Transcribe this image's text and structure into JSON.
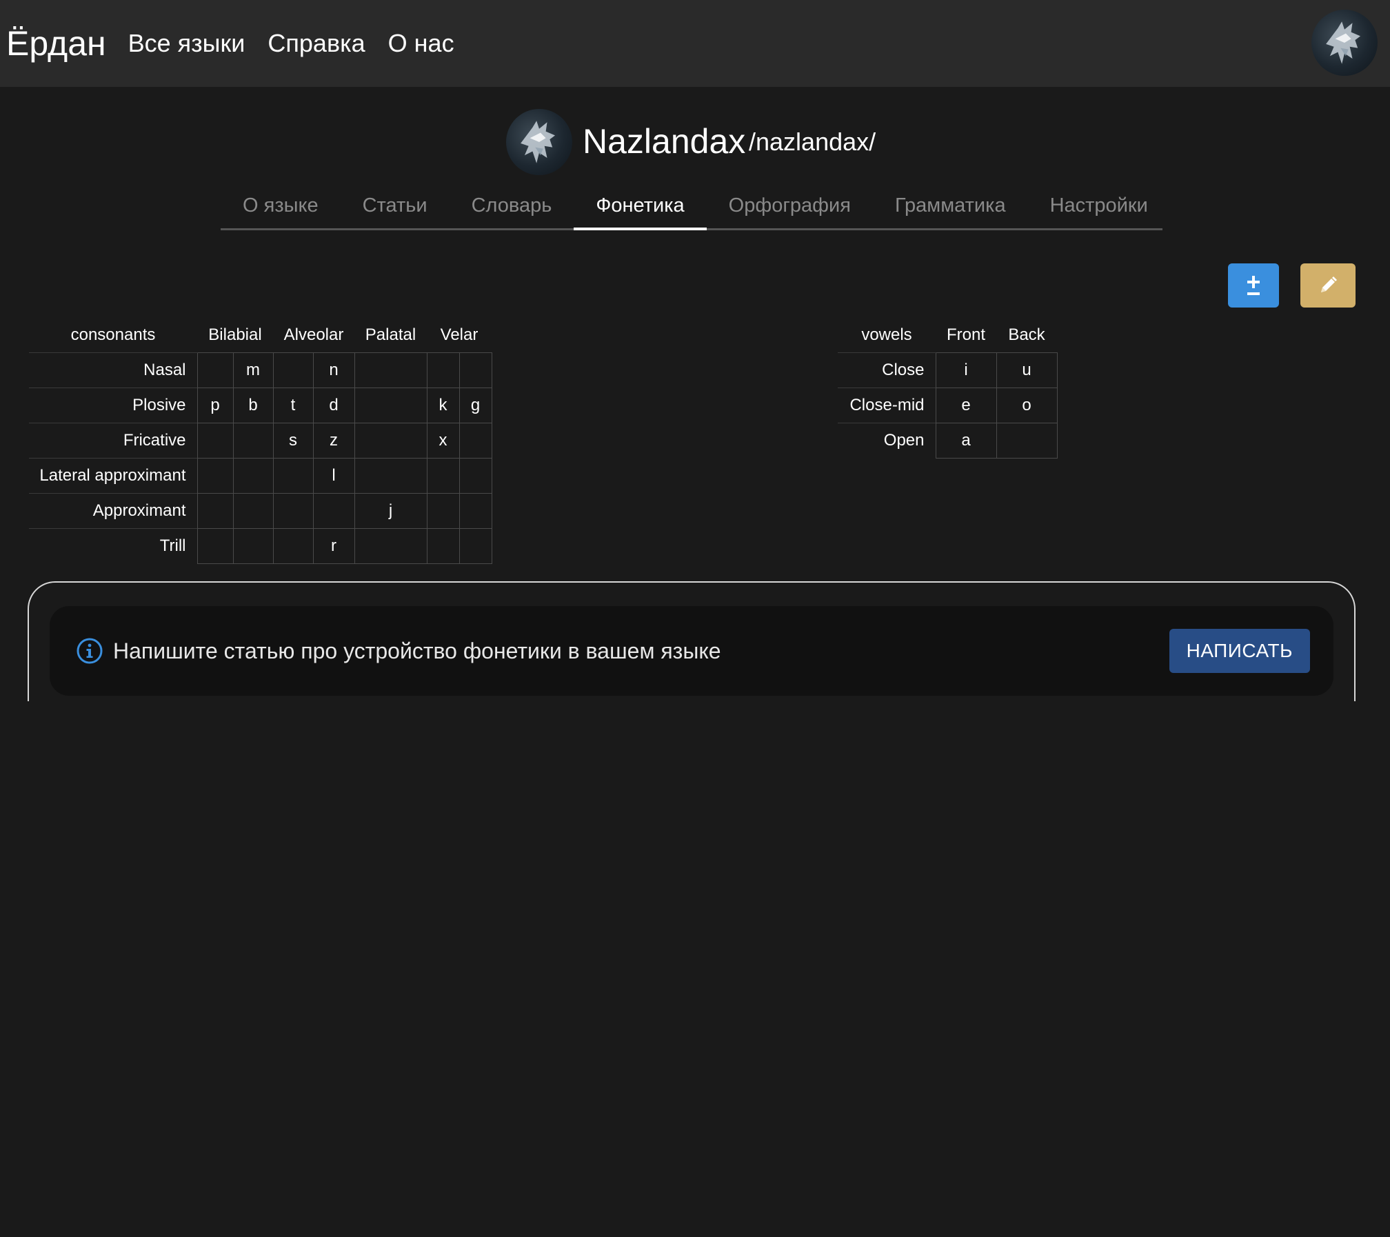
{
  "header": {
    "brand": "Ёрдан",
    "nav": [
      "Все языки",
      "Справка",
      "О нас"
    ]
  },
  "language": {
    "name": "Nazlandax",
    "transliteration": "/nazlandax/"
  },
  "tabs": [
    {
      "label": "О языке",
      "active": false
    },
    {
      "label": "Статьи",
      "active": false
    },
    {
      "label": "Словарь",
      "active": false
    },
    {
      "label": "Фонетика",
      "active": true
    },
    {
      "label": "Орфография",
      "active": false
    },
    {
      "label": "Грамматика",
      "active": false
    },
    {
      "label": "Настройки",
      "active": false
    }
  ],
  "toolbar": {
    "add_icon": "plus-minus-icon",
    "edit_icon": "pencil-icon",
    "add_color": "#3a8fde",
    "edit_color": "#d2b06a"
  },
  "consonants": {
    "title": "consonants",
    "places": [
      "Bilabial",
      "Alveolar",
      "Palatal",
      "Velar"
    ],
    "rows": [
      {
        "manner": "Nasal",
        "cells": [
          "",
          "m",
          "",
          "n",
          "",
          "",
          ""
        ]
      },
      {
        "manner": "Plosive",
        "cells": [
          "p",
          "b",
          "t",
          "d",
          "",
          "k",
          "g"
        ]
      },
      {
        "manner": "Fricative",
        "cells": [
          "",
          "",
          "s",
          "z",
          "",
          "x",
          ""
        ]
      },
      {
        "manner": "Lateral approximant",
        "cells": [
          "",
          "",
          "",
          "l",
          "",
          "",
          ""
        ]
      },
      {
        "manner": "Approximant",
        "cells": [
          "",
          "",
          "",
          "",
          "j",
          "",
          ""
        ]
      },
      {
        "manner": "Trill",
        "cells": [
          "",
          "",
          "",
          "r",
          "",
          "",
          ""
        ]
      }
    ]
  },
  "vowels": {
    "title": "vowels",
    "columns": [
      "Front",
      "Back"
    ],
    "rows": [
      {
        "height": "Close",
        "cells": [
          "i",
          "u"
        ]
      },
      {
        "height": "Close-mid",
        "cells": [
          "e",
          "o"
        ]
      },
      {
        "height": "Open",
        "cells": [
          "a",
          ""
        ]
      }
    ]
  },
  "hint": {
    "icon": "info-icon",
    "text": "Напишите статью про устройство фонетики в вашем языке",
    "button": "НАПИСАТЬ"
  }
}
